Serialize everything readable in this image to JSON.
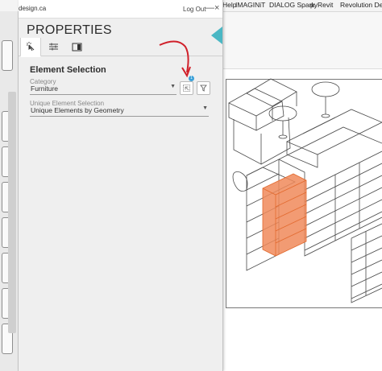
{
  "ribbon": {
    "tabs": [
      "Help",
      "IMAGINiT",
      "DIALOG Spark",
      "pyRevit",
      "Revolution Design"
    ]
  },
  "window": {
    "url_fragment": "design.ca",
    "logout_label": "Log Out",
    "minimize_glyph": "—",
    "close_glyph": "×"
  },
  "panel": {
    "title": "PROPERTIES",
    "tabs": [
      {
        "icon": "cursor-select-icon",
        "active": true
      },
      {
        "icon": "sliders-icon",
        "active": false
      },
      {
        "icon": "panel-icon",
        "active": false
      }
    ],
    "element_selection": {
      "heading": "Element Selection",
      "category_label": "Category",
      "category_value": "Furniture",
      "unique_label": "Unique Element Selection",
      "unique_value": "Unique Elements by Geometry",
      "badge_count": "1"
    }
  },
  "colors": {
    "accent_teal": "#4ab7c4",
    "selection_orange": "#f08a5a",
    "badge_blue": "#3aa0d8",
    "annotation_red": "#d0202a"
  }
}
